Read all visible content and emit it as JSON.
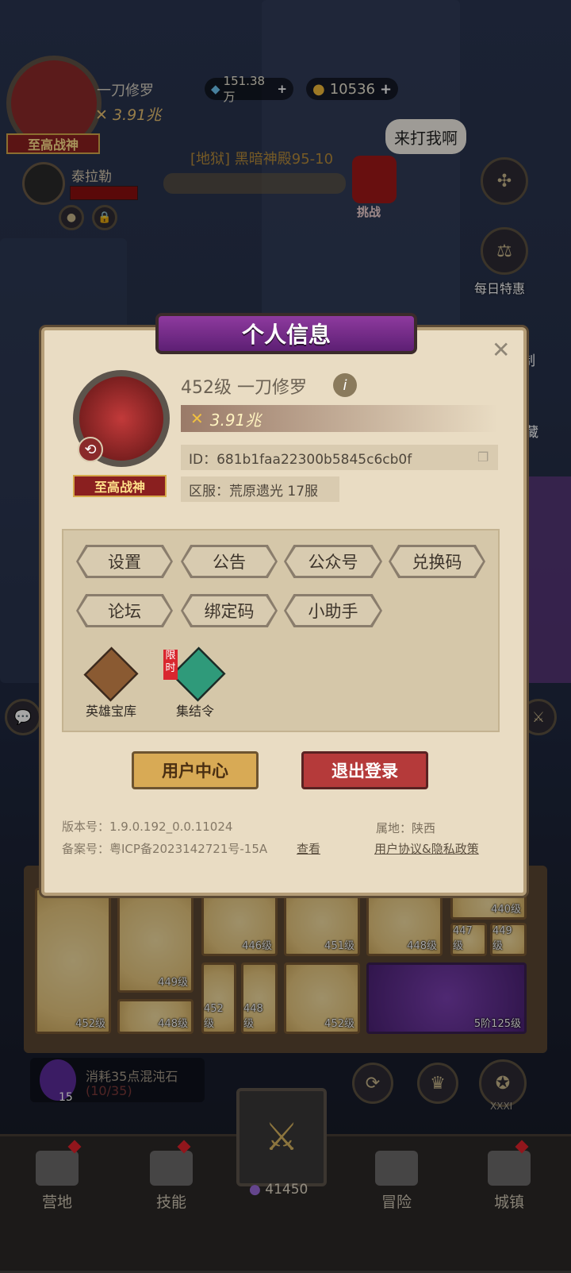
{
  "player": {
    "name": "一刀修罗",
    "power": "3.91兆",
    "rank_badge": "至高战神",
    "level_name": "452级  一刀修罗",
    "id": "ID：681b1faa22300b5845c6cb0f",
    "server": "区服：荒原遗光 17服"
  },
  "currency": {
    "gems": "151.38万",
    "coins": "10536"
  },
  "ally": {
    "name": "泰拉勒"
  },
  "stage": {
    "label": "[地狱] 黑暗神殿95-10",
    "challenge": "挑战",
    "speech": "来打我啊"
  },
  "side_menu": {
    "daily_deal": "每日特惠",
    "partial_1": "制",
    "partial_2": "藏"
  },
  "dialog": {
    "title": "个人信息",
    "buttons": [
      "设置",
      "公告",
      "公众号",
      "兑换码",
      "论坛",
      "绑定码",
      "小助手"
    ],
    "features": [
      {
        "label": "英雄宝库"
      },
      {
        "label": "集结令",
        "tag": "限时"
      }
    ],
    "user_center": "用户中心",
    "logout": "退出登录",
    "version": "版本号：1.9.0.192_0.0.11024",
    "record": "备案号：粤ICP备2023142721号-15A",
    "view": "查看",
    "location": "属地：陕西",
    "policy": "用户协议&隐私政策"
  },
  "inventory": {
    "levels": [
      "452级",
      "449级",
      "446级",
      "451级",
      "448级",
      "440级",
      "447级",
      "449级",
      "448级",
      "452级",
      "448级",
      "452级",
      "5阶125级"
    ]
  },
  "chaos": {
    "text": "消耗35点混沌石",
    "progress": "(10/35)",
    "count": "15"
  },
  "numeral": "XXXI",
  "nav": {
    "items": [
      "营地",
      "技能",
      "冒险",
      "城镇"
    ],
    "center_value": "41450"
  },
  "colors": {
    "accent_purple": "#7a2a8f",
    "logout_red": "#b53a3a",
    "user_center_gold": "#d8aa55"
  }
}
